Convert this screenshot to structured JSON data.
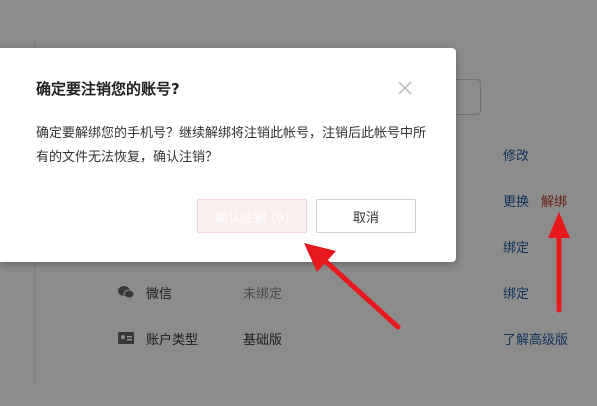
{
  "background": {
    "actions": {
      "modify": "修改",
      "replace": "更换",
      "unbind": "解绑",
      "bind_1": "绑定",
      "bind_2": "绑定",
      "learn_more": "了解高级版"
    },
    "rows": [
      {
        "label": "微信",
        "value": "未绑定"
      },
      {
        "label": "账户类型",
        "value": "基础版"
      }
    ]
  },
  "dialog": {
    "title": "确定要注销您的账号?",
    "message": "确定要解绑您的手机号？继续解绑将注销此帐号，注销后此帐号中所有的文件无法恢复，确认注销？",
    "confirm_label": "确认注销 (9)",
    "cancel_label": "取消"
  },
  "colors": {
    "link": "#1e5ba8",
    "danger": "#c0392b",
    "arrow": "#e8191c",
    "confirm_bg": "#fbeeee"
  }
}
